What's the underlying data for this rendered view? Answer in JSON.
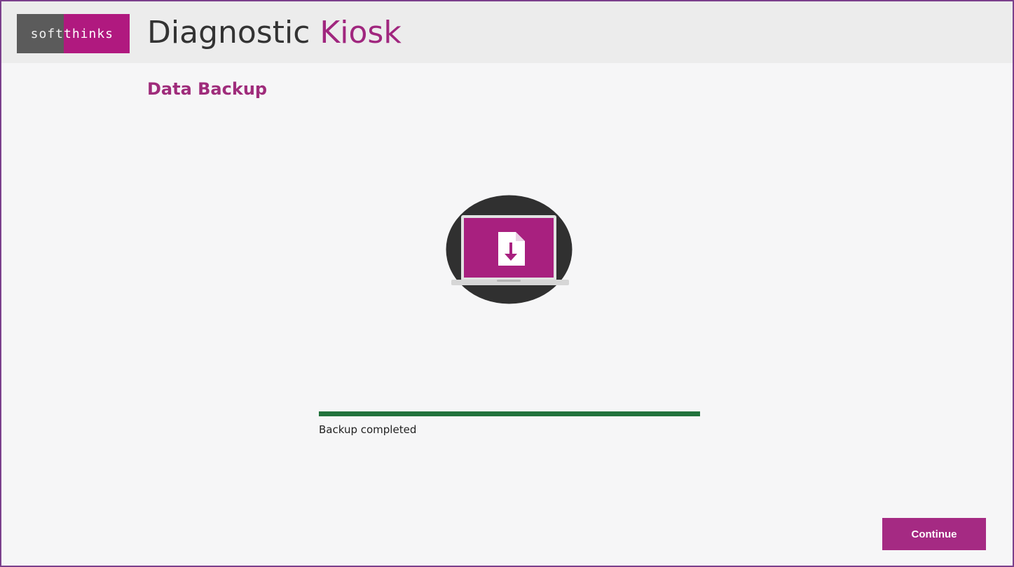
{
  "window": {
    "border_color": "#7b3f8c",
    "background_color": "#f6f6f7"
  },
  "header": {
    "logo": {
      "left_text": "soft",
      "right_text": "thinks",
      "left_color": "#5b5b5b",
      "right_color": "#b0197f"
    },
    "title_main": "Diagnostic ",
    "title_accent": "Kiosk",
    "accent_color": "#a0267e"
  },
  "main": {
    "title": "Data Backup",
    "illustration_icons": [
      "laptop-icon",
      "download-file-icon"
    ],
    "progress": {
      "value": 1,
      "fill_color": "#22733c"
    },
    "status_text": "Backup completed",
    "continue_label": "Continue",
    "button_color": "#a52a83"
  }
}
